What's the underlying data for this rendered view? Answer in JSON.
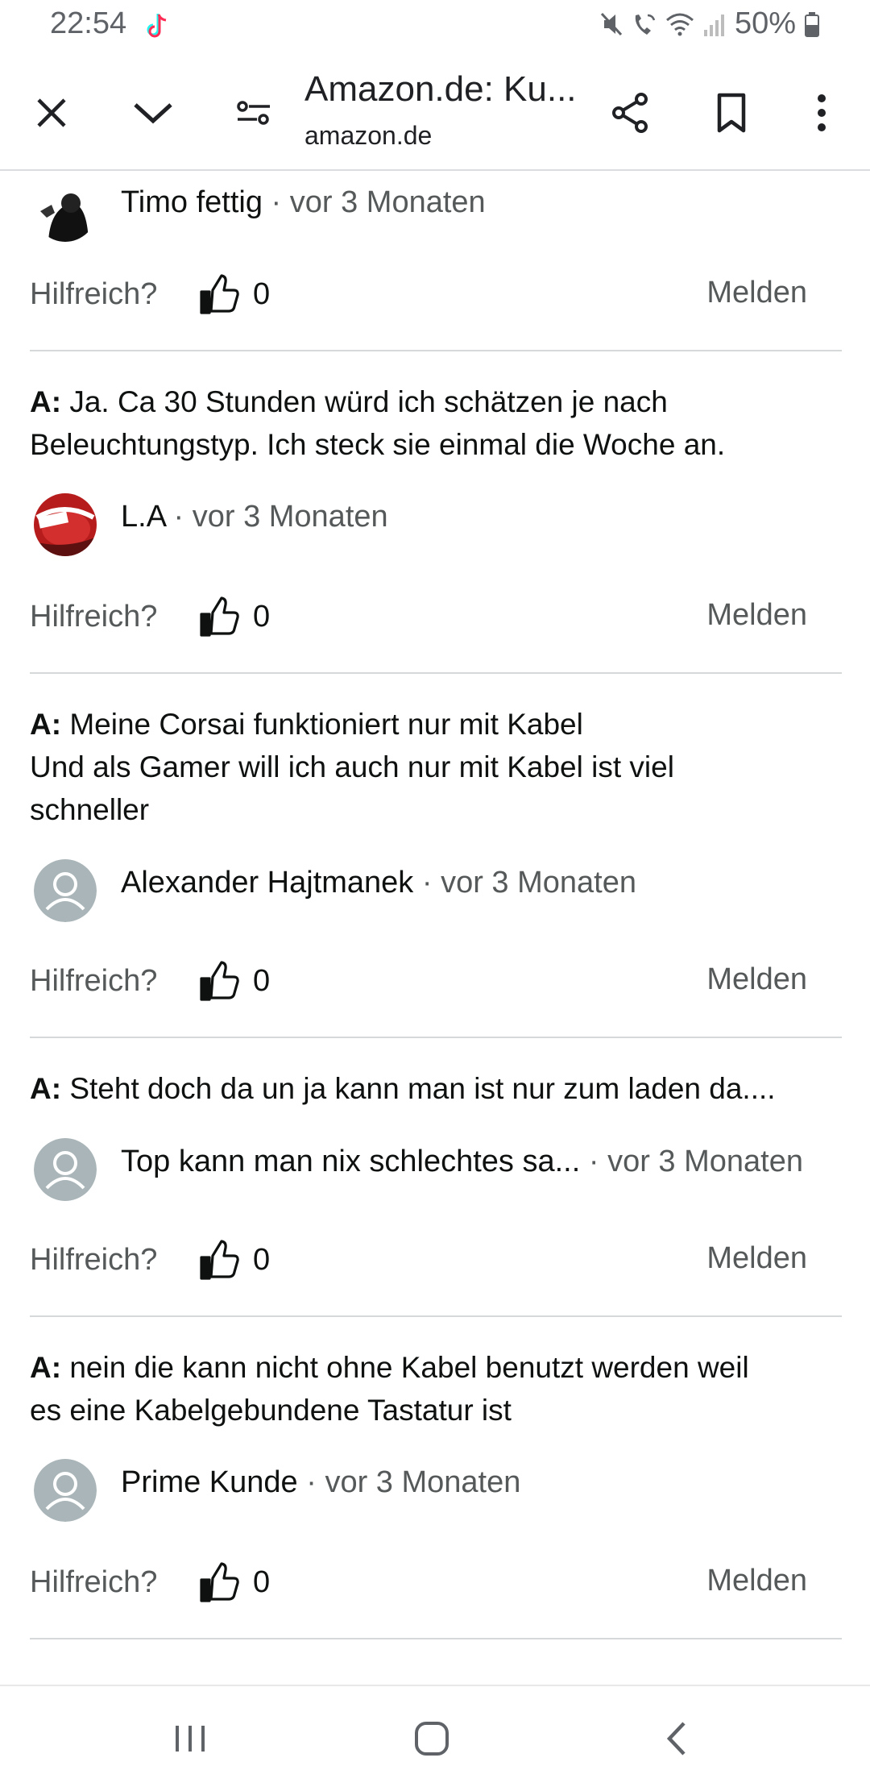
{
  "status_bar": {
    "time": "22:54",
    "battery": "50%",
    "icons": [
      "tiktok-icon",
      "mute-icon",
      "wifi-call-icon",
      "wifi-icon",
      "signal-icon",
      "battery-icon"
    ]
  },
  "toolbar": {
    "title": "Amazon.de: Ku...",
    "url": "amazon.de",
    "icons": [
      "close-icon",
      "chevron-down-icon",
      "site-settings-icon",
      "share-icon",
      "bookmark-icon",
      "more-vert-icon"
    ]
  },
  "labels": {
    "helpful": "Hilfreich?",
    "report": "Melden",
    "answer_prefix": "A:"
  },
  "entries": [
    {
      "answer_lines": [],
      "author": "Timo fettig",
      "meta": "· vor 3 Monaten",
      "helpful_count": "0"
    },
    {
      "answer_lines": [
        "Ja. Ca 30 Stunden würd ich schätzen je nach",
        "Beleuchtungstyp. Ich steck sie einmal die Woche an."
      ],
      "author": "L.A",
      "meta": "· vor 3 Monaten",
      "helpful_count": "0"
    },
    {
      "answer_lines": [
        "Meine Corsai funktioniert nur mit Kabel",
        "Und als Gamer will ich auch nur mit Kabel ist viel",
        "schneller"
      ],
      "author": "Alexander Hajtmanek",
      "meta": "· vor 3 Monaten",
      "helpful_count": "0"
    },
    {
      "answer_lines": [
        "Steht doch da un ja kann man ist nur zum laden da...."
      ],
      "author": "Top kann man nix schlechtes sa...",
      "meta": "· vor 3 Monaten",
      "helpful_count": "0"
    },
    {
      "answer_lines": [
        "nein die kann nicht ohne Kabel benutzt werden weil",
        "es eine Kabelgebundene Tastatur ist"
      ],
      "author": "Prime Kunde",
      "meta": "· vor 3 Monaten",
      "helpful_count": "0"
    }
  ],
  "nav_bar": {
    "icons": [
      "recent-apps-icon",
      "home-icon",
      "back-icon"
    ]
  }
}
